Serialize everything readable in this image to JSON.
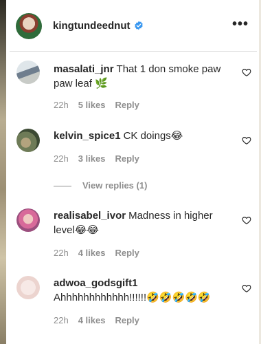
{
  "post_header": {
    "username": "kingtundeednut",
    "more_icon": "more-options-icon"
  },
  "comments": [
    {
      "username": "masalati_jnr",
      "text": "That 1 don smoke paw paw leaf 🌿",
      "time": "22h",
      "likes": "5 likes",
      "reply": "Reply"
    },
    {
      "username": "kelvin_spice1",
      "text": "CK doings😂",
      "time": "22h",
      "likes": "3 likes",
      "reply": "Reply"
    },
    {
      "username": "realisabel_ivor",
      "text": "Madness in higher level😂😂",
      "time": "22h",
      "likes": "4 likes",
      "reply": "Reply"
    },
    {
      "username": "adwoa_godsgift1",
      "text": "Ahhhhhhhhhhhh!!!!!!🤣🤣🤣🤣🤣",
      "time": "22h",
      "likes": "4 likes",
      "reply": "Reply"
    }
  ],
  "view_replies": "View replies (1)",
  "colors": {
    "text": "#262626",
    "meta": "#8e8e8e",
    "verified": "#3897f0",
    "divider": "#dbdbdb"
  }
}
